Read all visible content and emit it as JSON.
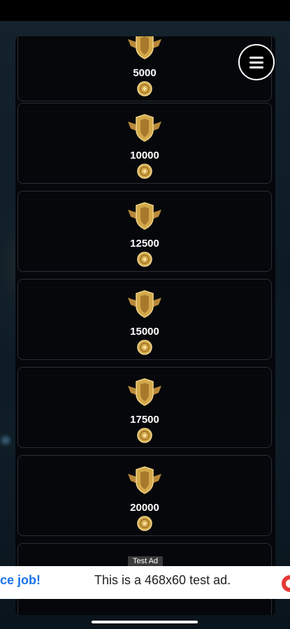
{
  "menu": {
    "icon": "hamburger-menu-icon"
  },
  "tiers": [
    {
      "amount": "5000",
      "badge_icon": "rank-badge-icon",
      "coin_icon": "coin-icon"
    },
    {
      "amount": "10000",
      "badge_icon": "rank-badge-icon",
      "coin_icon": "coin-icon"
    },
    {
      "amount": "12500",
      "badge_icon": "rank-badge-icon",
      "coin_icon": "coin-icon"
    },
    {
      "amount": "15000",
      "badge_icon": "rank-badge-icon",
      "coin_icon": "coin-icon"
    },
    {
      "amount": "17500",
      "badge_icon": "rank-badge-icon",
      "coin_icon": "coin-icon"
    },
    {
      "amount": "20000",
      "badge_icon": "rank-badge-icon",
      "coin_icon": "coin-icon"
    }
  ],
  "ad": {
    "label": "Test Ad",
    "left_text": "ce job!",
    "main_text": "This is a 468x60 test ad."
  },
  "colors": {
    "gold": "#d4a94a",
    "card_border": "#2a2f36",
    "ad_link": "#1a73e8"
  }
}
